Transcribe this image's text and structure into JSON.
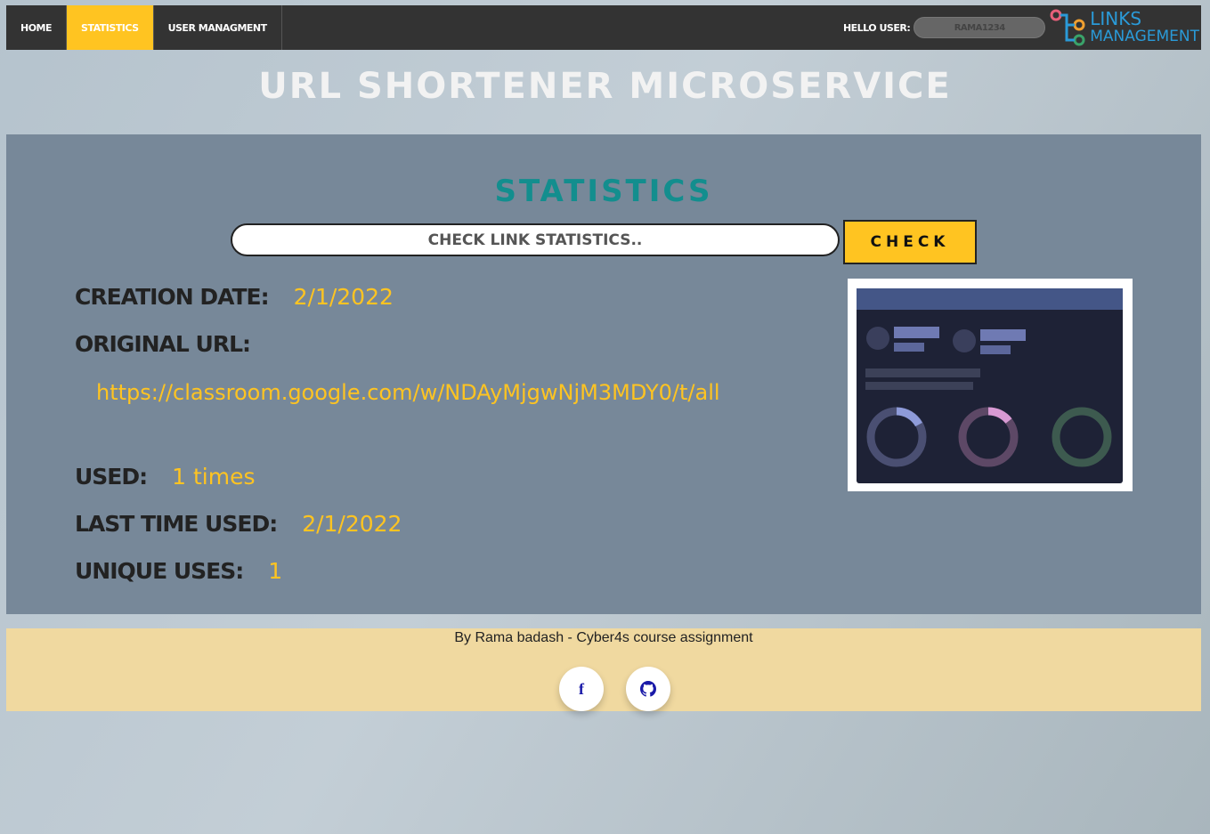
{
  "nav": {
    "items": [
      {
        "label": "HOME",
        "active": false
      },
      {
        "label": "STATISTICS",
        "active": true
      },
      {
        "label": "USER MANAGMENT",
        "active": false
      }
    ],
    "hello_label": "HELLO USER:",
    "username": "RAMA1234"
  },
  "logo": {
    "line1": "LINKS",
    "line2": "MANAGEMENT"
  },
  "page_title": "URL SHORTENER MICROSERVICE",
  "stats": {
    "heading": "STATISTICS",
    "search_placeholder": "CHECK LINK STATISTICS..",
    "check_label": "CHECK",
    "creation_date_label": "CREATION DATE:",
    "creation_date": "2/1/2022",
    "original_url_label": "ORIGINAL URL:",
    "original_url": "https://classroom.google.com/w/NDAyMjgwNjM3MDY0/t/all",
    "used_label": "USED:",
    "used": "1 times",
    "last_used_label": "LAST TIME USED:",
    "last_used": "2/1/2022",
    "unique_uses_label": "UNIQUE USES:",
    "unique_uses": "1"
  },
  "footer": {
    "text": "By Rama badash - Cyber4s course assignment",
    "icons": [
      "facebook-icon",
      "github-icon"
    ]
  },
  "colors": {
    "accent": "#ffc421",
    "nav_bg": "#333333",
    "panel_bg": "#778899",
    "heading_teal": "#138e8e",
    "footer_bg": "#f0d9a0"
  }
}
